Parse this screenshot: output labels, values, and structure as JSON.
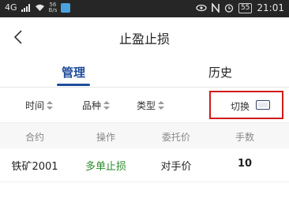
{
  "status_bar": {
    "signal": "4G",
    "network_speed_top": "56",
    "network_speed_bottom": "B/s",
    "battery": "55",
    "time": "21:01"
  },
  "header": {
    "title": "止盈止损"
  },
  "tabs": [
    {
      "label": "管理",
      "active": true
    },
    {
      "label": "历史",
      "active": false
    }
  ],
  "filters": {
    "time_label": "时间",
    "variety_label": "品种",
    "type_label": "类型",
    "switch_label": "切换"
  },
  "table": {
    "headers": [
      "合约",
      "操作",
      "委托价",
      "手数"
    ],
    "rows": [
      {
        "contract": "铁矿2001",
        "action": "多单止损",
        "price": "对手价",
        "lots": "10"
      }
    ]
  },
  "colors": {
    "accent": "#1f4c9a",
    "highlight_border": "#d11a1a",
    "action_text": "#2b8a2b"
  },
  "icons": [
    "back-arrow-icon",
    "sort-icon",
    "switch-view-icon",
    "wifi-icon",
    "battery-icon",
    "alarm-icon",
    "eye-icon",
    "nfc-icon"
  ]
}
